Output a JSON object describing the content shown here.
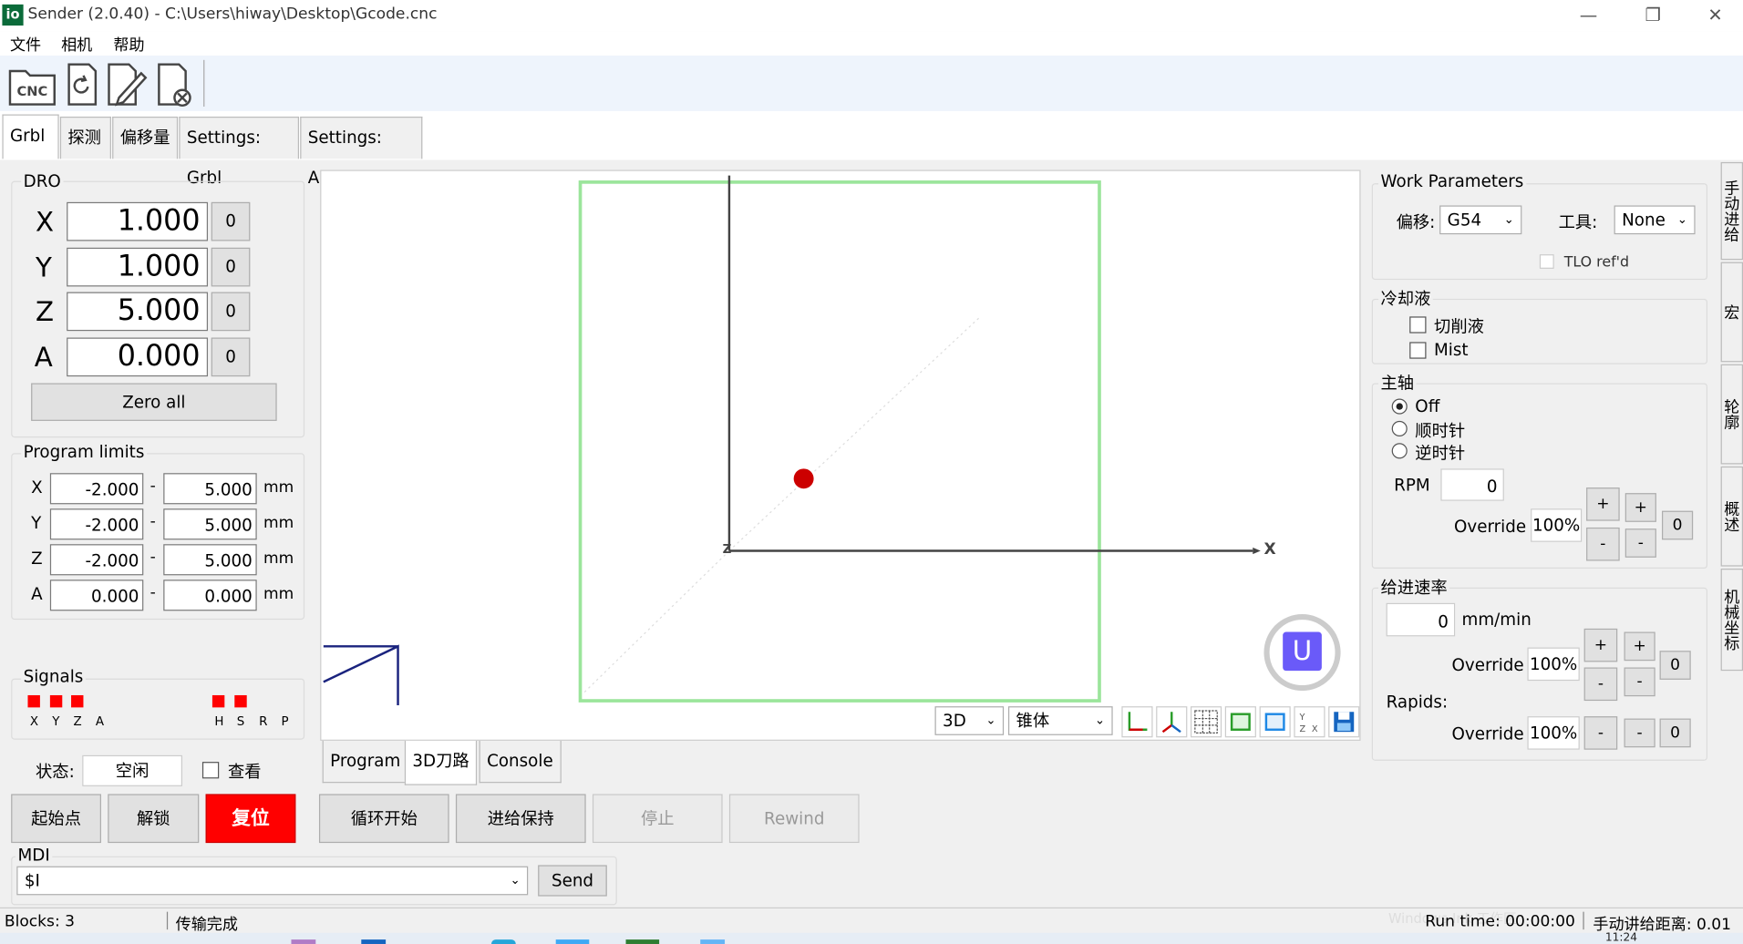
{
  "window": {
    "app_icon": "io",
    "title": "Sender (2.0.40) - C:\\Users\\hiway\\Desktop\\Gcode.cnc"
  },
  "menu": [
    "文件",
    "相机",
    "帮助"
  ],
  "toolbar": {
    "cnc_label": "CNC"
  },
  "tabs": [
    "Grbl",
    "探测",
    "偏移量",
    "Settings: Grbl",
    "Settings: App"
  ],
  "dro": {
    "title": "DRO",
    "axes": [
      {
        "name": "X",
        "value": "1.000",
        "zero": "0"
      },
      {
        "name": "Y",
        "value": "1.000",
        "zero": "0"
      },
      {
        "name": "Z",
        "value": "5.000",
        "zero": "0"
      },
      {
        "name": "A",
        "value": "0.000",
        "zero": "0"
      }
    ],
    "zero_all": "Zero all"
  },
  "limits": {
    "title": "Program limits",
    "rows": [
      {
        "axis": "X",
        "min": "-2.000",
        "max": "5.000",
        "unit": "mm"
      },
      {
        "axis": "Y",
        "min": "-2.000",
        "max": "5.000",
        "unit": "mm"
      },
      {
        "axis": "Z",
        "min": "-2.000",
        "max": "5.000",
        "unit": "mm"
      },
      {
        "axis": "A",
        "min": "0.000",
        "max": "0.000",
        "unit": "mm"
      }
    ],
    "sep": "-"
  },
  "signals": {
    "title": "Signals",
    "labels": [
      "X",
      "Y",
      "Z",
      "A",
      "H",
      "S",
      "R",
      "P"
    ],
    "on_color": "#ff0000"
  },
  "state": {
    "label": "状态:",
    "value": "空闲",
    "check_label": "查看"
  },
  "buttons": {
    "home": "起始点",
    "unlock": "解锁",
    "reset": "复位",
    "cycle_start": "循环开始",
    "feed_hold": "进给保持",
    "stop": "停止",
    "rewind": "Rewind"
  },
  "mdi": {
    "label": "MDI",
    "value": "$I",
    "send": "Send"
  },
  "view": {
    "mode": "3D",
    "tool_shape": "锥体",
    "axis_x": "X",
    "axis_z": "Z",
    "logo": "U",
    "tabs": [
      "Program",
      "3D刀路",
      "Console"
    ],
    "buttons": [
      "axis-xy",
      "axis-3d",
      "grid",
      "bounding-box",
      "view-fit",
      "view-zx",
      "save"
    ]
  },
  "work": {
    "title": "Work Parameters",
    "offset_label": "偏移:",
    "offset_value": "G54",
    "tool_label": "工具:",
    "tool_value": "None",
    "tlo_label": "TLO ref'd"
  },
  "coolant": {
    "title": "冷却液",
    "flood": "切削液",
    "mist": "Mist"
  },
  "spindle": {
    "title": "主轴",
    "options": [
      "Off",
      "顺时针",
      "逆时针"
    ],
    "rpm_label": "RPM",
    "rpm_value": "0",
    "override_label": "Override",
    "override_value": "100%",
    "plus": "+",
    "minus": "-",
    "zero": "0"
  },
  "feed": {
    "title": "给进速率",
    "value": "0",
    "unit": "mm/min",
    "override_label": "Override",
    "override_value": "100%",
    "rapids_label": "Rapids:",
    "rapids_override_value": "100%",
    "plus": "+",
    "minus": "-",
    "zero": "0"
  },
  "side_tabs": [
    "手动进给",
    "宏",
    "轮廓",
    "概述",
    "机械坐标"
  ],
  "statusbar": {
    "blocks": "Blocks: 3",
    "message": "传输完成",
    "runtime": "Run time: 00:00:00",
    "jog": "手动讲给距离: 0.01",
    "watermark": "Windows Ink 工作区",
    "clock": "11:24"
  }
}
